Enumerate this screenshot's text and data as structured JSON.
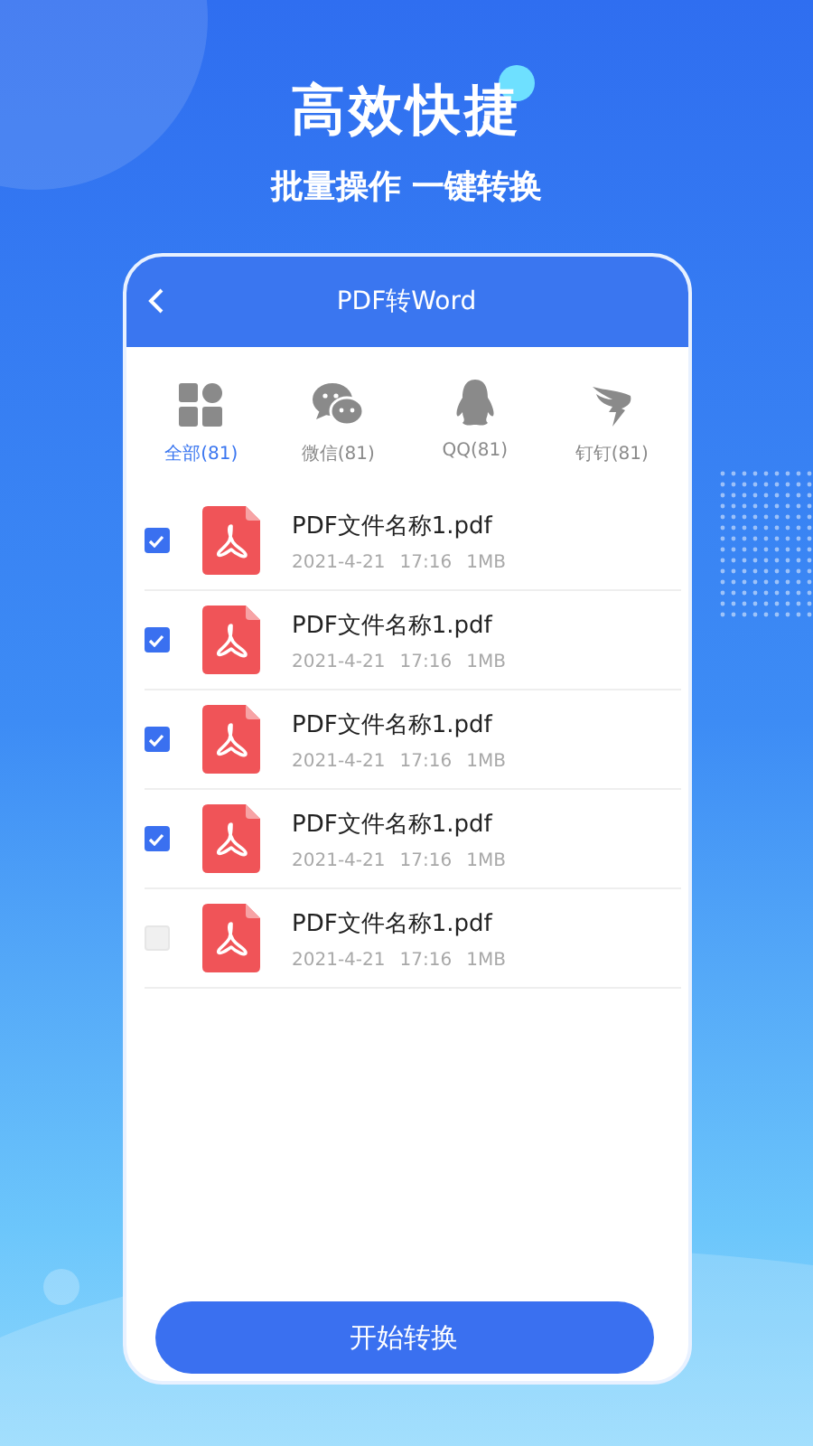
{
  "headline": "高效快捷",
  "subheadline": "批量操作 一键转换",
  "screen": {
    "title": "PDF转Word",
    "sources": [
      {
        "kind": "all",
        "label": "全部(81)",
        "selected": true
      },
      {
        "kind": "chat",
        "label": "微信(81)",
        "selected": false
      },
      {
        "kind": "penguin",
        "label": "QQ(81)",
        "selected": false
      },
      {
        "kind": "wing",
        "label": "钉钉(81)",
        "selected": false
      }
    ],
    "files": [
      {
        "name": "PDF文件名称1.pdf",
        "date": "2021-4-21",
        "time": "17:16",
        "size": "1MB",
        "checked": true
      },
      {
        "name": "PDF文件名称1.pdf",
        "date": "2021-4-21",
        "time": "17:16",
        "size": "1MB",
        "checked": true
      },
      {
        "name": "PDF文件名称1.pdf",
        "date": "2021-4-21",
        "time": "17:16",
        "size": "1MB",
        "checked": true
      },
      {
        "name": "PDF文件名称1.pdf",
        "date": "2021-4-21",
        "time": "17:16",
        "size": "1MB",
        "checked": true
      },
      {
        "name": "PDF文件名称1.pdf",
        "date": "2021-4-21",
        "time": "17:16",
        "size": "1MB",
        "checked": false
      }
    ],
    "action_button": "开始转换"
  }
}
